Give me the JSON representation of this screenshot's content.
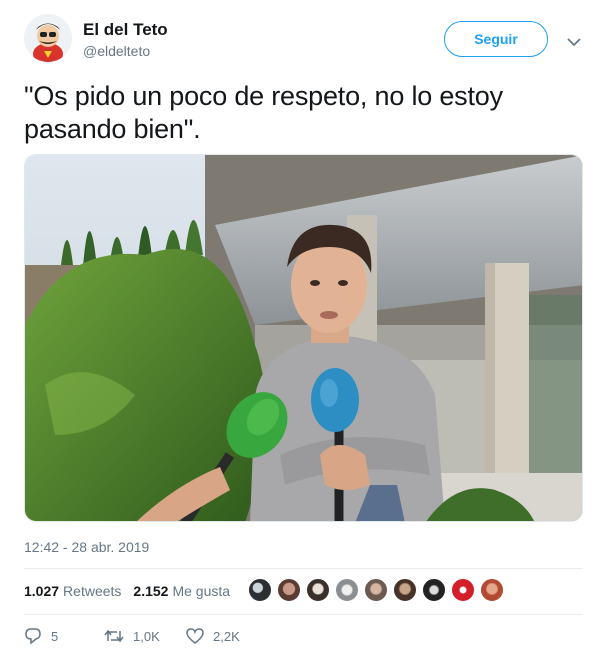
{
  "user": {
    "name": "El del Teto",
    "handle": "@eldelteto"
  },
  "follow_label": "Seguir",
  "tweet": {
    "text": "\"Os pido un poco de respeto, no lo estoy pasando bien\".",
    "timestamp": "12:42 - 28 abr. 2019"
  },
  "stats": {
    "retweets_count": "1.027",
    "retweets_label": "Retweets",
    "likes_count": "2.152",
    "likes_label": "Me gusta"
  },
  "actions": {
    "replies": "5",
    "retweets": "1,0K",
    "likes": "2,2K"
  },
  "icons": {
    "reply": "reply-icon",
    "retweet": "retweet-icon",
    "like": "heart-icon",
    "more": "chevron-down-icon"
  },
  "colors": {
    "accent": "#1da1f2",
    "secondary_text": "#657786",
    "primary_text": "#14171a"
  }
}
